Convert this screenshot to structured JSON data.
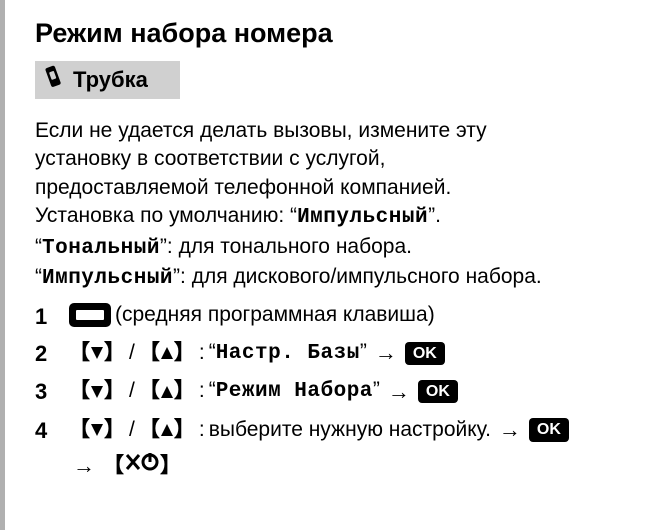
{
  "title": "Режим набора номера",
  "handset_label": "Трубка",
  "intro": {
    "line1": "Если не удается делать вызовы, измените эту",
    "line2": "установку в соответствии с услугой,",
    "line3": "предоставляемой телефонной компанией.",
    "default_prefix": "Установка по умолчанию: “",
    "default_value": "Импульсный",
    "default_suffix": "”.",
    "tone_label": "Тональный",
    "tone_desc": ": для тонального набора.",
    "pulse_label": "Импульсный",
    "pulse_desc": ": для дискового/импульсного набора."
  },
  "steps": [
    {
      "num": "1",
      "softkey_desc": "(средняя программная клавиша)"
    },
    {
      "num": "2",
      "menu_item": "Настр. Базы",
      "ok": "OK"
    },
    {
      "num": "3",
      "menu_item": "Режим Набора",
      "ok": "OK"
    },
    {
      "num": "4",
      "select_text": "выберите нужную настройку.",
      "ok": "OK"
    }
  ],
  "ok_label": "OK"
}
